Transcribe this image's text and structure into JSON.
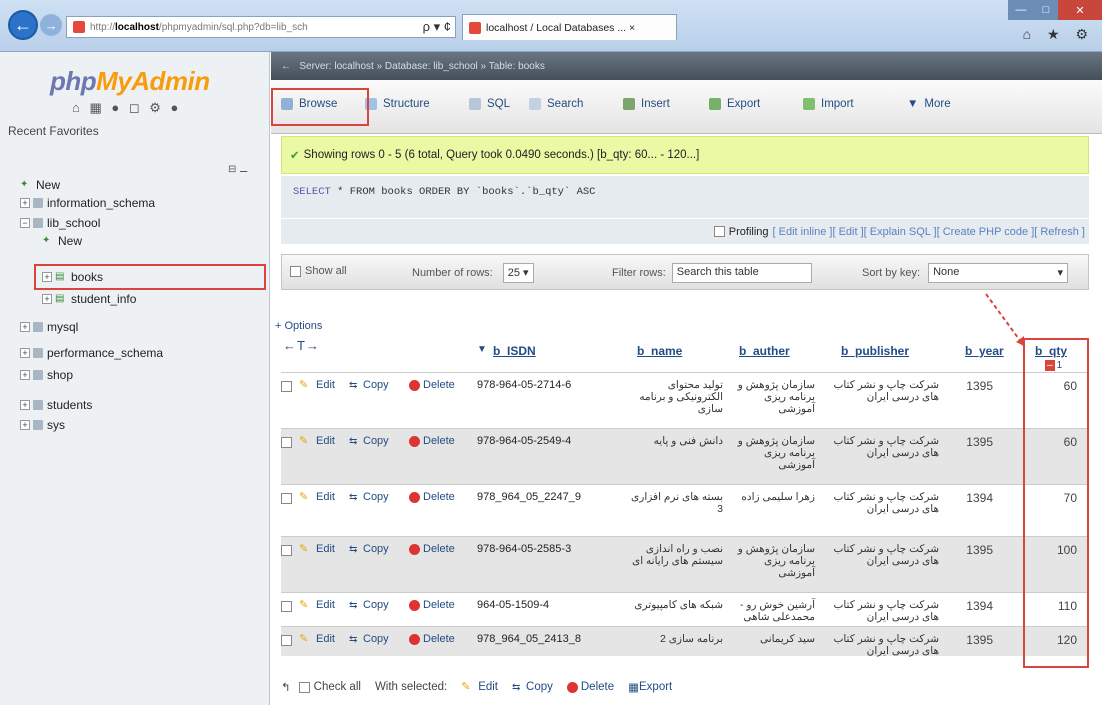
{
  "browser": {
    "url_prefix": "http://",
    "url_host": "localhost",
    "url_path": "/phpmyadmin/sql.php?db=lib_sch",
    "url_controls": "ρ ▾ ¢",
    "tab_title": "localhost / Local Databases ... ×",
    "right_icons": "⌂ ★ ⚙"
  },
  "sidebar": {
    "logo_a": "php",
    "logo_b": "MyAdmin",
    "recent": "Recent",
    "favorites": "Favorites",
    "tree": [
      {
        "label": "New"
      },
      {
        "label": "information_schema"
      },
      {
        "label": "lib_school"
      },
      {
        "label": "New"
      },
      {
        "label": "books"
      },
      {
        "label": "student_info"
      },
      {
        "label": "mysql"
      },
      {
        "label": "performance_schema"
      },
      {
        "label": "shop"
      },
      {
        "label": "students"
      },
      {
        "label": "sys"
      }
    ]
  },
  "tabs": [
    "Browse",
    "Structure",
    "SQL",
    "Search",
    "Insert",
    "Export",
    "Import",
    "More"
  ],
  "notice": "Showing rows 0 - 5 (6 total, Query took 0.0490 seconds.) [b_qty: 60... - 120...]",
  "sql": {
    "select": "SELECT",
    "from": "* FROM",
    "rest": "books ORDER BY `books`.`b_qty` ASC"
  },
  "profiling": {
    "label": "Profiling",
    "links": [
      "[ Edit inline ]",
      "[ Edit ]",
      "[ Explain SQL ]",
      "[ Create PHP code ]",
      "[ Refresh ]"
    ]
  },
  "navbar": {
    "show_all": "Show all",
    "rows_label": "Number of rows:",
    "rows_value": "25",
    "filter_label": "Filter rows:",
    "filter_placeholder": "Search this table",
    "sort_label": "Sort by key:",
    "sort_value": "None"
  },
  "options_link": "+ Options",
  "columns": [
    "b_ISDN",
    "b_name",
    "b_auther",
    "b_publisher",
    "b_year",
    "b_qty"
  ],
  "qty_sort_index": "1",
  "actions": {
    "edit": "Edit",
    "copy": "Copy",
    "delete": "Delete"
  },
  "rows": [
    {
      "isdn": "978-964-05-2714-6",
      "name": "تولید محتوای الکترونیکی و برنامه سازی",
      "auther": "سازمان پژوهش و برنامه ریزی آموزشی",
      "publisher": "شرکت چاپ و نشر کتاب های درسی ایران",
      "year": "1395",
      "qty": "60"
    },
    {
      "isdn": "978-964-05-2549-4",
      "name": "دانش فنی و پایه",
      "auther": "سازمان پژوهش و برنامه ریزی آموزشی",
      "publisher": "شرکت چاپ و نشر کتاب های درسی ایران",
      "year": "1395",
      "qty": "60"
    },
    {
      "isdn": "978_964_05_2247_9",
      "name": "بسته های نرم افزاری 3",
      "auther": "زهرا سلیمی زاده",
      "publisher": "شرکت چاپ و نشر کتاب های درسی ایران",
      "year": "1394",
      "qty": "70"
    },
    {
      "isdn": "978-964-05-2585-3",
      "name": "نصب و راه اندازی سیستم های رایانه ای",
      "auther": "سازمان پژوهش و برنامه ریزی آموزشی",
      "publisher": "شرکت چاپ و نشر کتاب های درسی ایران",
      "year": "1395",
      "qty": "100"
    },
    {
      "isdn": "964-05-1509-4",
      "name": "شبکه های کامپیوتری",
      "auther": "آرشین خوش رو - محمدعلی شاهی",
      "publisher": "شرکت چاپ و نشر کتاب های درسی ایران",
      "year": "1394",
      "qty": "110"
    },
    {
      "isdn": "978_964_05_2413_8",
      "name": "برنامه سازی 2",
      "auther": "سید کریمانی",
      "publisher": "شرکت چاپ و نشر کتاب های درسی ایران",
      "year": "1395",
      "qty": "120"
    }
  ],
  "footer": {
    "check_all": "Check all",
    "with_selected": "With selected:",
    "edit": "Edit",
    "copy": "Copy",
    "delete": "Delete",
    "export": "Export"
  }
}
